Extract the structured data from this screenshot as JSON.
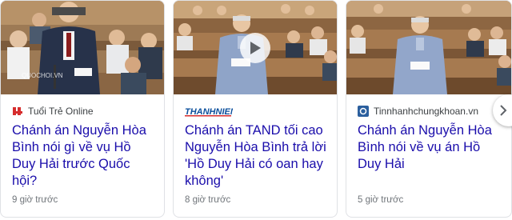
{
  "cards": [
    {
      "source": "Tuổi Trẻ Online",
      "headline": "Chánh án Nguyễn Hòa Bình nói gì về vụ Hồ Duy Hải trước Quốc hội?",
      "time": "9 giờ trước",
      "watermark": "QUOCHOI.VN",
      "icon": "tuoi-tre-logo-icon"
    },
    {
      "source": "THANHNIEN",
      "headline": "Chánh án TAND tối cao Nguyễn Hòa Bình trả lời 'Hồ Duy Hải có oan hay không'",
      "time": "8 giờ trước",
      "icon": "play-icon"
    },
    {
      "source": "Tinnhanhchungkhoan.vn",
      "headline": "Chánh án Nguyễn Hòa Bình nói về vụ án Hồ Duy Hải",
      "time": "5 giờ trước",
      "icon": "tinnhanh-logo-icon"
    }
  ],
  "next_button": {
    "icon": "chevron-right-icon"
  },
  "colors": {
    "headline": "#1a0dab",
    "meta": "#70757a",
    "thanhnien": "#0b4f9c",
    "tuoitre": "#d62d2d"
  }
}
